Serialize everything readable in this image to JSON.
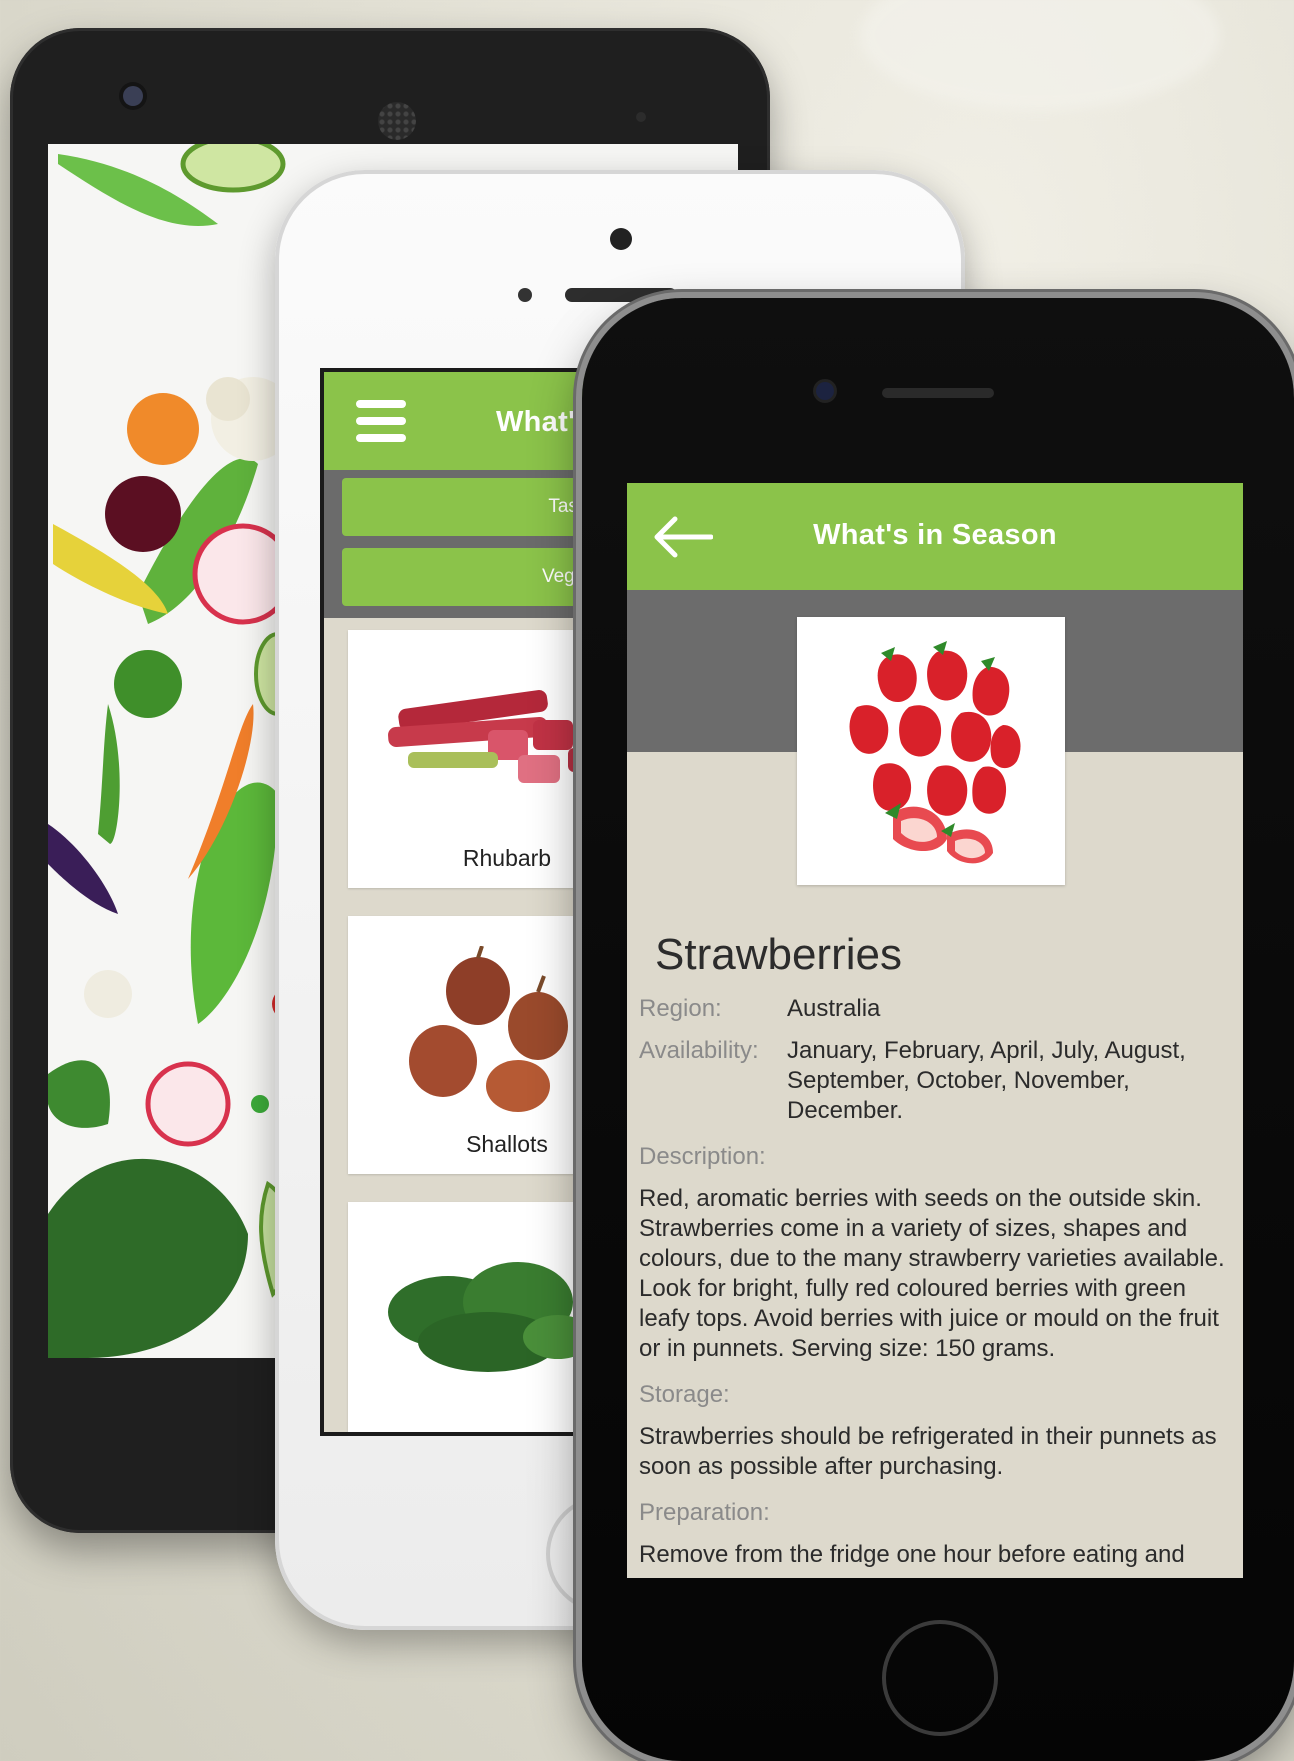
{
  "colors": {
    "accent_green": "#8bc34a",
    "header_band_gray": "#6c6c6c",
    "content_bg": "#ddd9cc"
  },
  "middle_screen": {
    "title": "What's in Season",
    "menu_icon": "hamburger-menu-icon",
    "filters": [
      "Tasmania",
      "Vegetables"
    ],
    "items": [
      {
        "label": "Rhubarb",
        "image": "rhubarb-image"
      },
      {
        "label": "Shallots",
        "image": "shallots-image"
      },
      {
        "label": "",
        "image": "spinach-image"
      }
    ]
  },
  "detail_screen": {
    "title": "What's in Season",
    "back_icon": "back-arrow-icon",
    "image": "strawberries-image",
    "name": "Strawberries",
    "region_label": "Region:",
    "region_value": "Australia",
    "availability_label": "Availability:",
    "availability_value": "January, February, April, July, August, September, October, November, December.",
    "description_label": "Description:",
    "description_text": "Red, aromatic berries with seeds on the outside skin. Strawberries come in a variety of sizes, shapes and colours, due to the many strawberry varieties available. Look for bright, fully red coloured berries with green leafy tops. Avoid berries with juice or mould on the fruit or in punnets. Serving size: 150 grams.",
    "storage_label": "Storage:",
    "storage_text": "Strawberries should be refrigerated in their punnets as soon as possible after purchasing.",
    "preparation_label": "Preparation:",
    "preparation_text": "Remove from the fridge one hour before eating and"
  }
}
